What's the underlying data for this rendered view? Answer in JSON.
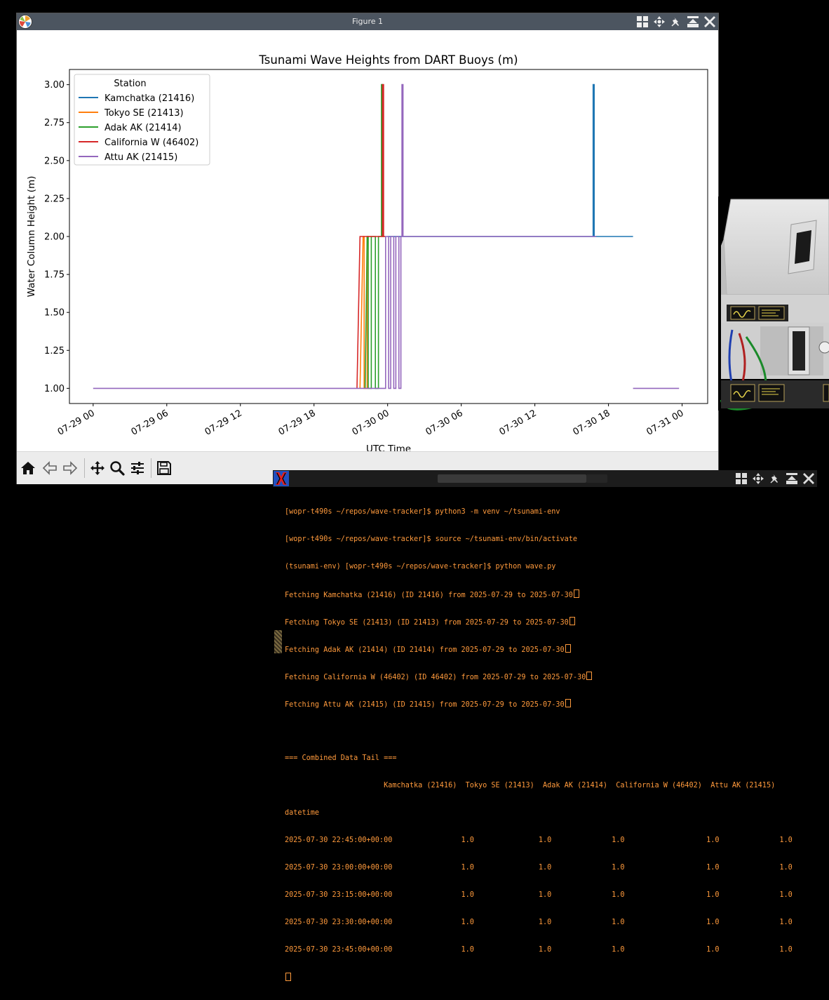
{
  "figure_window": {
    "title": "Figure 1"
  },
  "chart_data": {
    "type": "line",
    "title": "Tsunami Wave Heights from DART Buoys (m)",
    "xlabel": "UTC Time",
    "ylabel": "Water Column Height (m)",
    "x_ticks": [
      "07-29 00",
      "07-29 06",
      "07-29 12",
      "07-29 18",
      "07-30 00",
      "07-30 06",
      "07-30 12",
      "07-30 18",
      "07-31 00"
    ],
    "y_ticks": [
      "1.00",
      "1.25",
      "1.50",
      "1.75",
      "2.00",
      "2.25",
      "2.50",
      "2.75",
      "3.00"
    ],
    "xlim": [
      "2025-07-28 22:04",
      "2025-07-31 02:05"
    ],
    "ylim": [
      0.9,
      3.1
    ],
    "grid": false,
    "legend": {
      "title": "Station",
      "position": "upper left"
    },
    "series": [
      {
        "name": "Kamchatka (21416)",
        "color": "#1f77b4",
        "points": [
          [
            "2025-07-30 00:00",
            2.0
          ],
          [
            "2025-07-30 16:45",
            2.0
          ],
          [
            "2025-07-30 16:45",
            3.0
          ],
          [
            "2025-07-30 16:50",
            3.0
          ],
          [
            "2025-07-30 16:50",
            2.0
          ],
          [
            "2025-07-30 20:00",
            2.0
          ]
        ]
      },
      {
        "name": "Tokyo SE (21413)",
        "color": "#ff7f0e",
        "points": [
          [
            "2025-07-29 21:45",
            1.0
          ],
          [
            "2025-07-29 22:00",
            2.0
          ],
          [
            "2025-07-29 22:05",
            2.0
          ],
          [
            "2025-07-29 22:05",
            1.0
          ],
          [
            "2025-07-29 22:20",
            1.0
          ],
          [
            "2025-07-29 22:20",
            2.0
          ],
          [
            "2025-07-29 22:40",
            2.0
          ]
        ]
      },
      {
        "name": "Adak AK (21414)",
        "color": "#2ca02c",
        "points": [
          [
            "2025-07-29 22:10",
            1.0
          ],
          [
            "2025-07-29 22:20",
            2.0
          ],
          [
            "2025-07-29 22:25",
            2.0
          ],
          [
            "2025-07-29 22:25",
            1.0
          ],
          [
            "2025-07-29 22:40",
            1.0
          ],
          [
            "2025-07-29 22:40",
            2.0
          ],
          [
            "2025-07-29 23:00",
            2.0
          ],
          [
            "2025-07-29 23:00",
            1.0
          ],
          [
            "2025-07-29 23:15",
            1.0
          ],
          [
            "2025-07-29 23:15",
            2.0
          ],
          [
            "2025-07-29 23:30",
            2.0
          ],
          [
            "2025-07-29 23:30",
            3.0
          ],
          [
            "2025-07-29 23:35",
            3.0
          ],
          [
            "2025-07-29 23:35",
            2.0
          ],
          [
            "2025-07-29 23:45",
            2.0
          ]
        ]
      },
      {
        "name": "California W (46402)",
        "color": "#d62728",
        "points": [
          [
            "2025-07-29 21:30",
            1.0
          ],
          [
            "2025-07-29 21:45",
            2.0
          ],
          [
            "2025-07-29 23:35",
            2.0
          ],
          [
            "2025-07-29 23:35",
            3.0
          ],
          [
            "2025-07-29 23:40",
            3.0
          ],
          [
            "2025-07-29 23:40",
            2.0
          ],
          [
            "2025-07-29 23:50",
            2.0
          ]
        ]
      },
      {
        "name": "Attu AK (21415)",
        "color": "#9467bd",
        "points": [
          [
            "2025-07-29 00:00",
            1.0
          ],
          [
            "2025-07-29 23:50",
            1.0
          ],
          [
            "2025-07-29 23:50",
            2.0
          ],
          [
            "2025-07-30 00:05",
            2.0
          ],
          [
            "2025-07-30 00:05",
            1.0
          ],
          [
            "2025-07-30 00:15",
            1.0
          ],
          [
            "2025-07-30 00:15",
            2.0
          ],
          [
            "2025-07-30 00:30",
            2.0
          ],
          [
            "2025-07-30 00:30",
            1.0
          ],
          [
            "2025-07-30 00:40",
            1.0
          ],
          [
            "2025-07-30 00:40",
            2.0
          ],
          [
            "2025-07-30 00:55",
            2.0
          ],
          [
            "2025-07-30 00:55",
            1.0
          ],
          [
            "2025-07-30 01:05",
            1.0
          ],
          [
            "2025-07-30 01:05",
            2.0
          ],
          [
            "2025-07-30 01:10",
            2.0
          ],
          [
            "2025-07-30 01:10",
            3.0
          ],
          [
            "2025-07-30 01:15",
            3.0
          ],
          [
            "2025-07-30 01:15",
            2.0
          ],
          [
            "2025-07-30 17:00",
            2.0
          ],
          [
            "2025-07-30 17:00",
            null
          ],
          [
            "2025-07-30 20:00",
            1.0
          ],
          [
            "2025-07-30 23:45",
            1.0
          ]
        ]
      }
    ]
  },
  "toolbar": {
    "buttons": [
      "home-icon",
      "back-arrow-icon",
      "forward-arrow-icon",
      "pan-icon",
      "zoom-icon",
      "configure-subplots-icon",
      "save-icon"
    ]
  },
  "terminal": {
    "lines": [
      "[wopr-t490s ~/repos/wave-tracker]$ python3 -m venv ~/tsunami-env",
      "[wopr-t490s ~/repos/wave-tracker]$ source ~/tsunami-env/bin/activate",
      "(tsunami-env) [wopr-t490s ~/repos/wave-tracker]$ python wave.py",
      "Fetching Kamchatka (21416) (ID 21416) from 2025-07-29 to 2025-07-30",
      "Fetching Tokyo SE (21413) (ID 21413) from 2025-07-29 to 2025-07-30",
      "Fetching Adak AK (21414) (ID 21414) from 2025-07-29 to 2025-07-30",
      "Fetching California W (46402) (ID 46402) from 2025-07-29 to 2025-07-30",
      "Fetching Attu AK (21415) (ID 21415) from 2025-07-29 to 2025-07-30",
      "",
      "=== Combined Data Tail ===",
      "                       Kamchatka (21416)  Tokyo SE (21413)  Adak AK (21414)  California W (46402)  Attu AK (21415)",
      "datetime",
      "2025-07-30 22:45:00+00:00                1.0               1.0              1.0                   1.0              1.0",
      "2025-07-30 23:00:00+00:00                1.0               1.0              1.0                   1.0              1.0",
      "2025-07-30 23:15:00+00:00                1.0               1.0              1.0                   1.0              1.0",
      "2025-07-30 23:30:00+00:00                1.0               1.0              1.0                   1.0              1.0",
      "2025-07-30 23:45:00+00:00                1.0               1.0              1.0                   1.0              1.0"
    ],
    "cursor_lines": [
      3,
      4,
      5,
      6,
      7
    ]
  }
}
